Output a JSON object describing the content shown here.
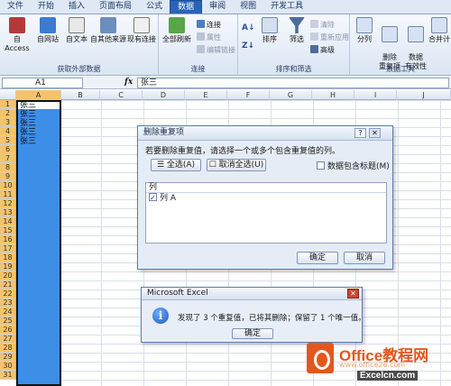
{
  "ribbon": {
    "tabs": [
      "文件",
      "开始",
      "插入",
      "页面布局",
      "公式",
      "数据",
      "审阅",
      "视图",
      "开发工具"
    ],
    "active_tab": "数据",
    "groups": {
      "external": {
        "label": "获取外部数据",
        "buttons": [
          "自 Access",
          "自网站",
          "自文本",
          "自其他来源",
          "现有连接"
        ]
      },
      "connections": {
        "label": "连接",
        "refresh_all": "全部刷新",
        "connections": "连接",
        "properties": "属性",
        "edit_links": "编辑链接"
      },
      "sort_filter": {
        "label": "排序和筛选",
        "sort": "排序",
        "filter": "筛选",
        "clear": "清除",
        "reapply": "重新应用",
        "advanced": "高级"
      },
      "data_tools": {
        "label": "数据工具",
        "text_to_columns": "分列",
        "remove_duplicates": "删除\n重复项",
        "validation": "数据\n有效性",
        "consolidate": "合并计"
      }
    }
  },
  "formula_bar": {
    "name_box": "A1",
    "fx": "fx",
    "content": "张三"
  },
  "sheet": {
    "columns": [
      "A",
      "B",
      "C",
      "D",
      "E",
      "F",
      "G",
      "H",
      "I",
      "J"
    ],
    "rows": [
      "1",
      "2",
      "3",
      "4",
      "5",
      "6",
      "7",
      "8",
      "9",
      "10",
      "11",
      "12",
      "13",
      "14",
      "15",
      "16",
      "17",
      "18",
      "19",
      "20",
      "21",
      "22",
      "23",
      "24",
      "25",
      "26",
      "27",
      "28",
      "29",
      "30",
      "31"
    ],
    "column_a_values": [
      "张三",
      "张三",
      "张三",
      "张三",
      "张三"
    ]
  },
  "remove_duplicates_dialog": {
    "title": "删除重复项",
    "prompt": "若要删除重复值，请选择一个或多个包含重复值的列。",
    "select_all": "全选(A)",
    "unselect_all": "取消全选(U)",
    "has_headers": "数据包含标题(M)",
    "list_header": "列",
    "columns": [
      "列 A"
    ],
    "ok": "确定",
    "cancel": "取消"
  },
  "message_box": {
    "title": "Microsoft Excel",
    "text": "发现了 3 个重复值，已将其删除；保留了 1 个唯一值。",
    "ok": "确定"
  },
  "watermark": {
    "brand": "Office教程网",
    "url": "www.office26.com",
    "sub": "Excelcn.com"
  },
  "colors": {
    "selection": "#3d8ee6",
    "active_tab": "#2a63b8",
    "watermark": "#e2571e"
  }
}
